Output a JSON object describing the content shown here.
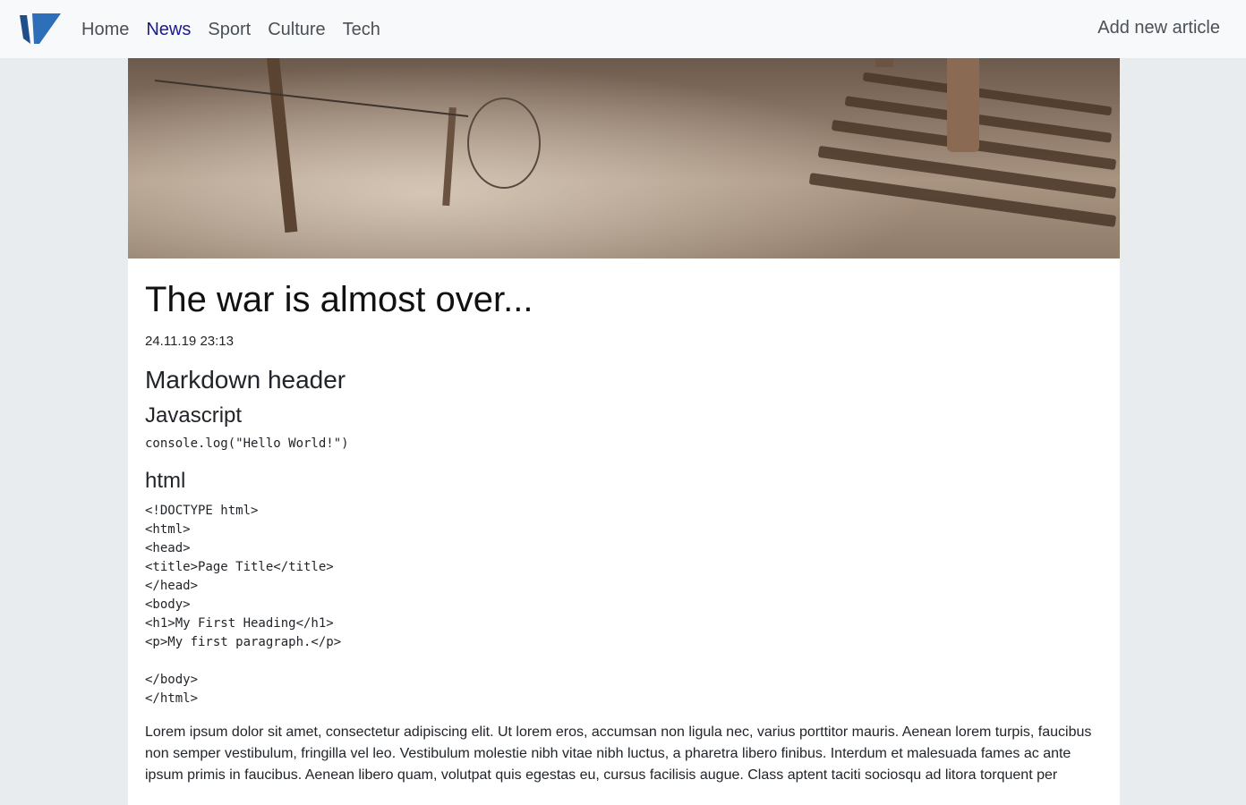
{
  "nav": {
    "logo": "logo-mark",
    "links": [
      {
        "label": "Home",
        "active": false
      },
      {
        "label": "News",
        "active": true
      },
      {
        "label": "Sport",
        "active": false
      },
      {
        "label": "Culture",
        "active": false
      },
      {
        "label": "Tech",
        "active": false
      }
    ],
    "add_article": "Add new article"
  },
  "article": {
    "title": "The war is almost over...",
    "date": "24.11.19 23:13",
    "markdown_header": "Markdown header",
    "js_heading": "Javascript",
    "js_code": "console.log(\"Hello World!\")",
    "html_heading": "html",
    "html_code": [
      "<!DOCTYPE html>",
      "<html>",
      "<head>",
      "<title>Page Title</title>",
      "</head>",
      "<body>",
      "<h1>My First Heading</h1>",
      "<p>My first paragraph.</p>",
      "",
      "</body>",
      "</html>"
    ],
    "paragraph": "Lorem ipsum dolor sit amet, consectetur adipiscing elit. Ut lorem eros, accumsan non ligula nec, varius porttitor mauris. Aenean lorem turpis, faucibus non semper vestibulum, fringilla vel leo. Vestibulum molestie nibh vitae nibh luctus, a pharetra libero finibus. Interdum et malesuada fames ac ante ipsum primis in faucibus. Aenean libero quam, volutpat quis egestas eu, cursus facilisis augue. Class aptent taciti sociosqu ad litora torquent per"
  },
  "colors": {
    "navbar_bg": "#f8f9fa",
    "page_bg": "#e9ecef",
    "active_link": "#1a1a8a",
    "logo_blue": "#1f4f8a"
  }
}
